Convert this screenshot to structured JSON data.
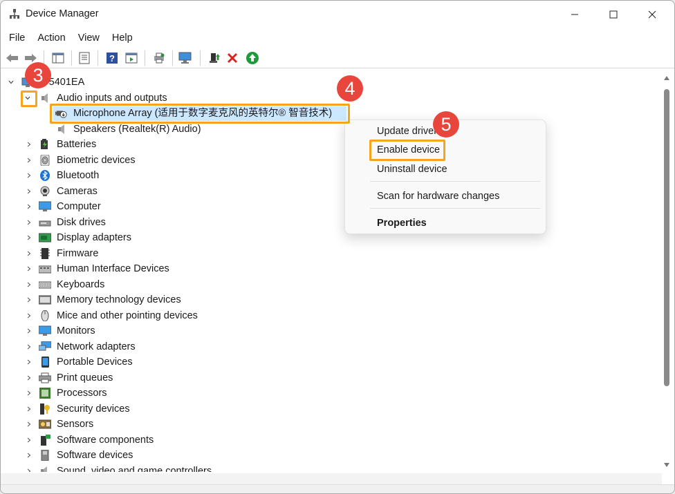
{
  "window": {
    "title": "Device Manager"
  },
  "menu": [
    "File",
    "Action",
    "View",
    "Help"
  ],
  "toolbar_icons": [
    "back-arrow-icon",
    "forward-arrow-icon",
    "show-hide-console-tree-icon",
    "properties-icon",
    "help-icon",
    "details-view-icon",
    "print-icon",
    "monitor-scan-icon",
    "update-driver-icon",
    "uninstall-x-icon",
    "enable-device-icon"
  ],
  "tree": {
    "root": "P5401EA",
    "audio_group": "Audio inputs and outputs",
    "audio_children": [
      "Microphone Array (适用于数字麦克风的英特尔® 智音技术)",
      "Speakers (Realtek(R) Audio)"
    ],
    "categories": [
      "Batteries",
      "Biometric devices",
      "Bluetooth",
      "Cameras",
      "Computer",
      "Disk drives",
      "Display adapters",
      "Firmware",
      "Human Interface Devices",
      "Keyboards",
      "Memory technology devices",
      "Mice and other pointing devices",
      "Monitors",
      "Network adapters",
      "Portable Devices",
      "Print queues",
      "Processors",
      "Security devices",
      "Sensors",
      "Software components",
      "Software devices",
      "Sound, video and game controllers"
    ]
  },
  "context_menu": {
    "update": "Update driver",
    "enable": "Enable device",
    "uninstall": "Uninstall device",
    "scan": "Scan for hardware changes",
    "properties": "Properties"
  },
  "annotations": {
    "step3": "3",
    "step4": "4",
    "step5": "5"
  },
  "colors": {
    "highlight": "#f4a51c",
    "badge": "#e8453c",
    "selection": "#cce8ff"
  }
}
